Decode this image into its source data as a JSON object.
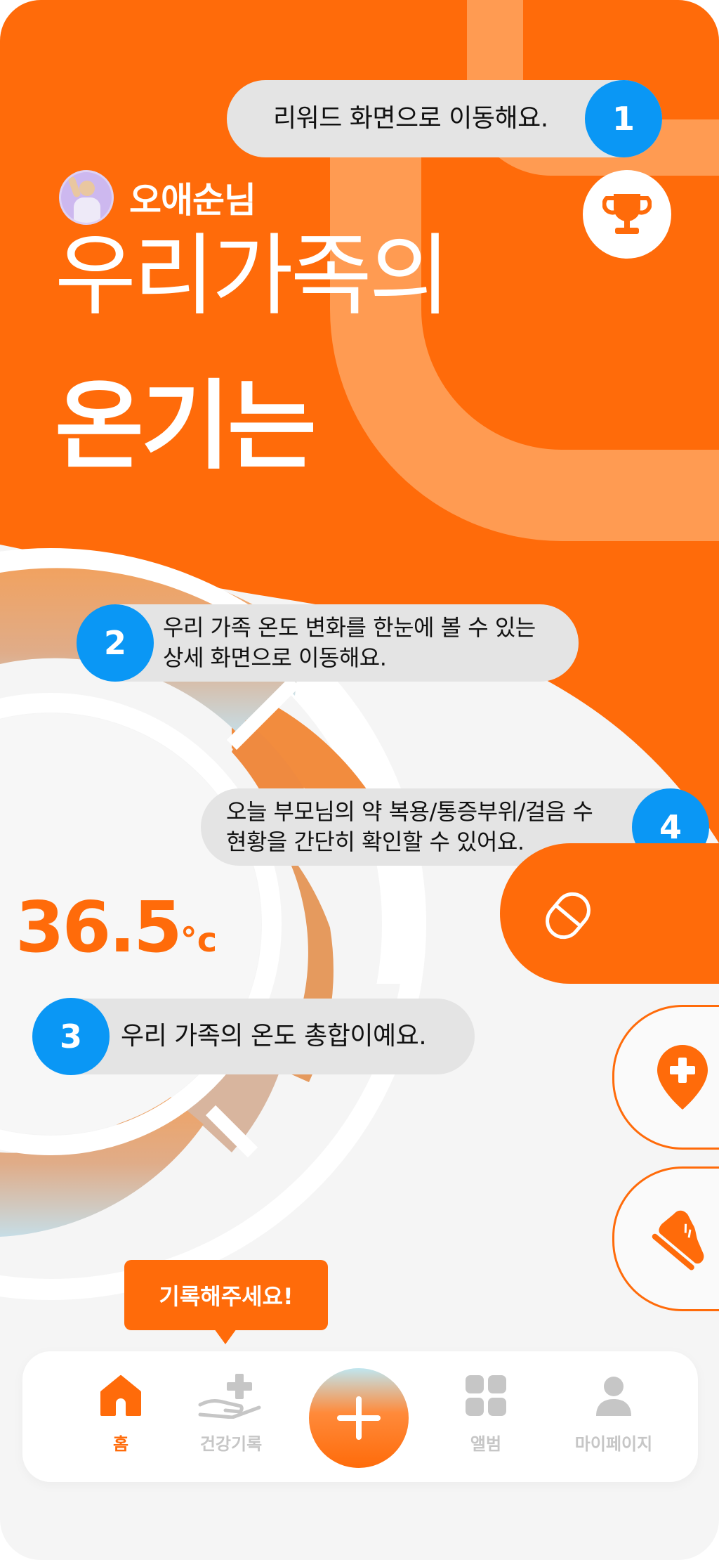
{
  "user": {
    "name": "오애순님"
  },
  "headline": {
    "line1": "우리가족의",
    "line2": "온기는"
  },
  "temperature": {
    "value": "36.5",
    "unit": "°c"
  },
  "tips": [
    {
      "number": "1",
      "text": "리워드 화면으로 이동해요."
    },
    {
      "number": "2",
      "line1": "우리 가족 온도 변화를 한눈에 볼 수 있는",
      "line2": "상세 화면으로 이동해요."
    },
    {
      "number": "3",
      "text": "우리 가족의 온도 총합이예요."
    },
    {
      "number": "4",
      "line1": "오늘 부모님의 약 복용/통증부위/걸음 수",
      "line2": "현황을 간단히 확인할 수 있어요."
    }
  ],
  "record_prompt": "기록해주세요!",
  "nav": {
    "home": "홈",
    "health": "건강기록",
    "album": "앨범",
    "mypage": "마이페이지"
  },
  "icons": {
    "reward": "trophy-icon",
    "medicine": "pill-icon",
    "pain": "pain-location-icon",
    "steps": "shoe-icon",
    "add": "plus-icon"
  },
  "colors": {
    "accent": "#ff6b0a",
    "tip_badge": "#0a97f5",
    "tip_bg": "#e4e4e4",
    "inactive": "#c6c6c6"
  }
}
